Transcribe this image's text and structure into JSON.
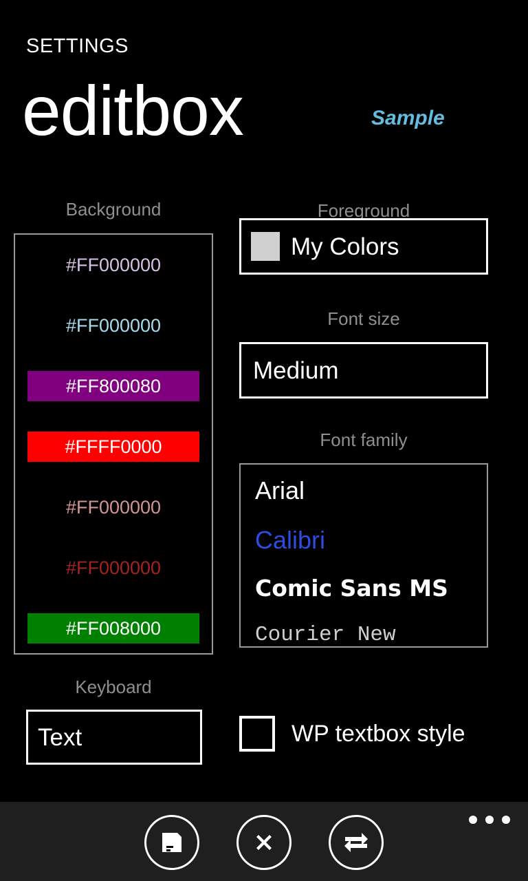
{
  "header": {
    "app_title": "SETTINGS",
    "page_title": "editbox",
    "sample_label": "Sample",
    "sample_color": "#62bde0"
  },
  "labels": {
    "background": "Background",
    "foreground": "Foreground",
    "font_size": "Font size",
    "font_family": "Font family",
    "keyboard": "Keyboard"
  },
  "background_list": {
    "items": [
      {
        "value": "#FF000000",
        "text_color": "#d6c2e4",
        "row_background": "transparent",
        "selected": false
      },
      {
        "value": "#FF000000",
        "text_color": "#a5dcec",
        "row_background": "transparent",
        "selected": false
      },
      {
        "value": "#FF800080",
        "text_color": "#ffffff",
        "row_background": "#800080",
        "selected": true
      },
      {
        "value": "#FFFF0000",
        "text_color": "#ffffff",
        "row_background": "#ff0000",
        "selected": true
      },
      {
        "value": "#FF000000",
        "text_color": "#d29494",
        "row_background": "transparent",
        "selected": false
      },
      {
        "value": "#FF000000",
        "text_color": "#a32222",
        "row_background": "transparent",
        "selected": false
      },
      {
        "value": "#FF008000",
        "text_color": "#ffffff",
        "row_background": "#008000",
        "selected": true
      }
    ]
  },
  "foreground": {
    "selected": "My Colors",
    "swatch_color": "#d0d0d0"
  },
  "font_size": {
    "selected": "Medium"
  },
  "font_family": {
    "items": [
      {
        "label": "Arial",
        "color": "#ffffff"
      },
      {
        "label": "Calibri",
        "color": "#2b4de0"
      },
      {
        "label": "Comic Sans MS",
        "color": "#ffffff"
      },
      {
        "label": "Courier New",
        "color": "#cfcfcf"
      }
    ]
  },
  "keyboard": {
    "selected": "Text"
  },
  "wp_textbox_style": {
    "label": "WP textbox style",
    "checked": false
  },
  "appbar": {
    "buttons": [
      {
        "icon": "save-icon",
        "name": "save-button"
      },
      {
        "icon": "close-icon",
        "name": "cancel-button"
      },
      {
        "icon": "swap-icon",
        "name": "swap-button"
      }
    ],
    "more_icon": "more-dots-icon"
  }
}
